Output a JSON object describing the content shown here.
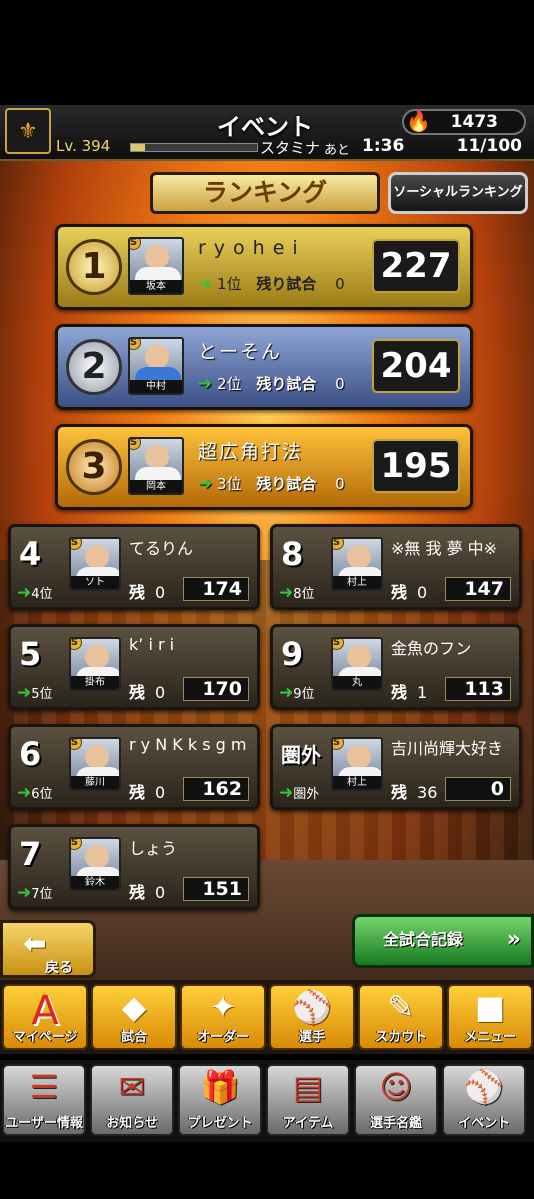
{
  "header": {
    "title": "イベント",
    "currency": "1473",
    "level_label": "Lv.",
    "level": "394",
    "stamina_label": "スタミナ",
    "stamina_fraction": 0.11,
    "ato_label": "あと",
    "timer": "1:36",
    "stamina_count": "11/100"
  },
  "tabs": {
    "ranking": "ランキング",
    "social": "ソーシャルランキング"
  },
  "rem_label": "残り試合",
  "rem_short": "残",
  "top3": [
    {
      "rank": "1",
      "name": "ryohei",
      "player": "坂本",
      "pos": "1位",
      "remaining": "0",
      "score": "227"
    },
    {
      "rank": "2",
      "name": "とーそん",
      "player": "中村",
      "pos": "2位",
      "remaining": "0",
      "score": "204"
    },
    {
      "rank": "3",
      "name": "超広角打法",
      "player": "岡本",
      "pos": "3位",
      "remaining": "0",
      "score": "195"
    }
  ],
  "others": [
    {
      "rank": "4",
      "name": "てるりん",
      "player": "ソト",
      "pos": "4位",
      "remaining": "0",
      "score": "174"
    },
    {
      "rank": "8",
      "name": "※無 我 夢 中※",
      "player": "村上",
      "pos": "8位",
      "remaining": "0",
      "score": "147"
    },
    {
      "rank": "5",
      "name": "k’ i r i",
      "player": "掛布",
      "pos": "5位",
      "remaining": "0",
      "score": "170"
    },
    {
      "rank": "9",
      "name": "金魚のフン",
      "player": "丸",
      "pos": "9位",
      "remaining": "1",
      "score": "113"
    },
    {
      "rank": "6",
      "name": "r y N K k s g m",
      "player": "藤川",
      "pos": "6位",
      "remaining": "0",
      "score": "162"
    },
    {
      "rank": "圏外",
      "name": "吉川尚輝大好き",
      "player": "村上",
      "pos": "圏外",
      "remaining": "36",
      "score": "0"
    },
    {
      "rank": "7",
      "name": "しょう",
      "player": "鈴木",
      "pos": "7位",
      "remaining": "0",
      "score": "151"
    }
  ],
  "buttons": {
    "back": "戻る",
    "record": "全試合記録"
  },
  "nav_main": [
    {
      "label": "マイページ",
      "icon": "A"
    },
    {
      "label": "試合",
      "icon": "◆"
    },
    {
      "label": "オーダー",
      "icon": "✦"
    },
    {
      "label": "選手",
      "icon": "⚾"
    },
    {
      "label": "スカウト",
      "icon": "✎"
    },
    {
      "label": "メニュー",
      "icon": "■"
    }
  ],
  "nav_sub": [
    {
      "label": "ユーザー情報",
      "icon": "☰"
    },
    {
      "label": "お知らせ",
      "icon": "✉"
    },
    {
      "label": "プレゼント",
      "icon": "🎁"
    },
    {
      "label": "アイテム",
      "icon": "▤"
    },
    {
      "label": "選手名鑑",
      "icon": "☺"
    },
    {
      "label": "イベント",
      "icon": "⚾"
    }
  ]
}
